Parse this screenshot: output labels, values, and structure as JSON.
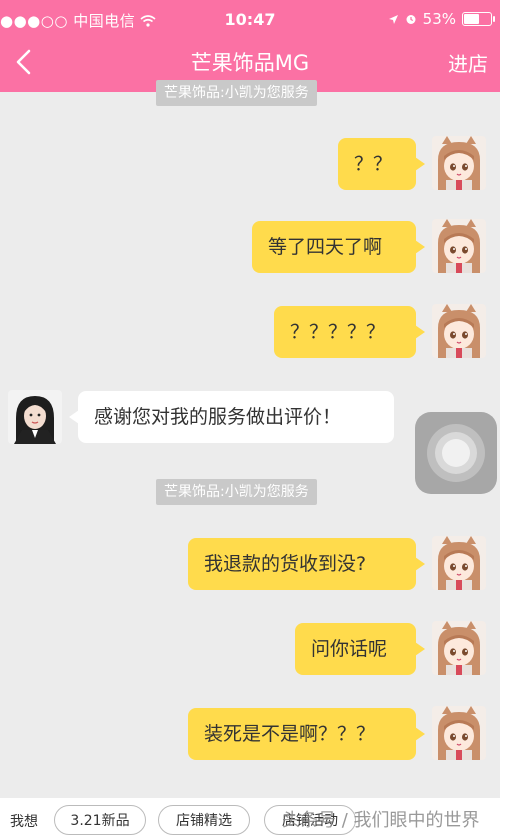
{
  "status_bar": {
    "signal": "●●●○○ 中国电信 ",
    "time": "10:47",
    "battery": "53%"
  },
  "header": {
    "title": "芒果饰品MG",
    "enter_store": "进店"
  },
  "system_notes": {
    "top_partial": "芒果饰品:小凯为您服务",
    "middle": "芒果饰品:小凯为您服务"
  },
  "messages": [
    {
      "sender": "me",
      "text": "？？"
    },
    {
      "sender": "me",
      "text": "等了四天了啊"
    },
    {
      "sender": "me",
      "text": "？？？？？"
    },
    {
      "sender": "shop",
      "text": "感谢您对我的服务做出评价！"
    },
    {
      "sender": "me",
      "text": "我退款的货收到没?"
    },
    {
      "sender": "me",
      "text": "问你话呢"
    },
    {
      "sender": "me",
      "text": "装死是不是啊？？？"
    }
  ],
  "quick_bar": {
    "label": "我想",
    "chips": [
      "3.21新品",
      "店铺精选",
      "店铺活动"
    ]
  },
  "watermark": "头条号 / 我们眼中的世界",
  "colors": {
    "header": "#fb71a4",
    "my_bubble": "#ffdb4c",
    "shop_bubble": "#ffffff",
    "background": "#ececec"
  }
}
